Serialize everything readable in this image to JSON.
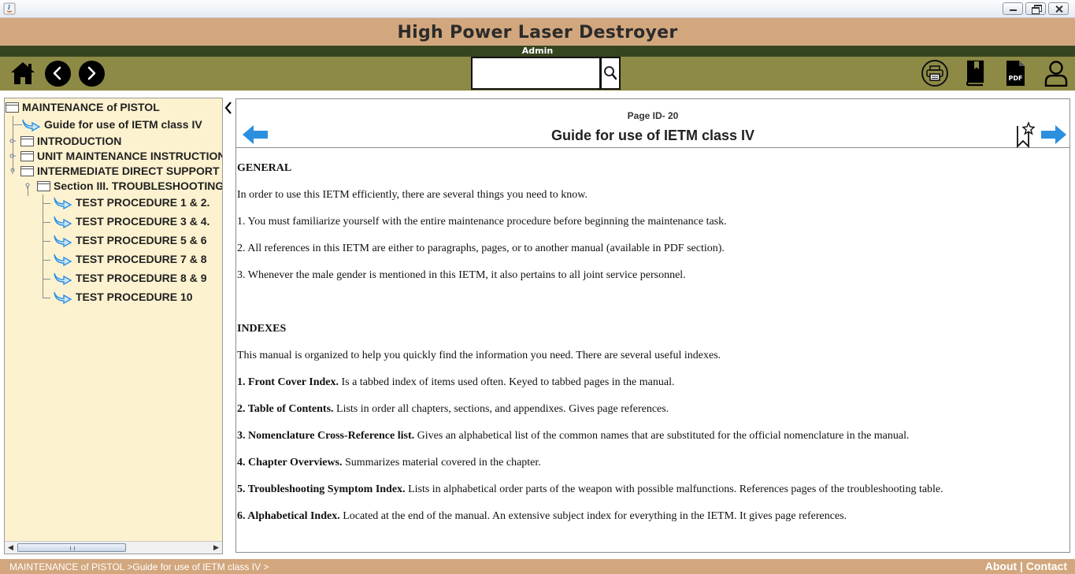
{
  "window": {
    "title": ""
  },
  "header": {
    "title": "High Power Laser Destroyer",
    "user": "Admin"
  },
  "toolbar": {
    "left_icons": [
      "home-icon",
      "back-icon",
      "forward-icon"
    ],
    "search": {
      "value": "",
      "placeholder": ""
    },
    "right_icons": [
      "printer-icon",
      "book-icon",
      "pdf-icon",
      "user-icon"
    ],
    "pdf_label": "PDF"
  },
  "sidebar": {
    "root": "MAINTENANCE of PISTOL",
    "items": [
      {
        "label": "Guide for use of IETM class IV",
        "type": "page"
      },
      {
        "label": "INTRODUCTION",
        "type": "folder"
      },
      {
        "label": "UNIT MAINTENANCE INSTRUCTION",
        "type": "folder"
      },
      {
        "label": "INTERMEDIATE DIRECT SUPPORT I",
        "type": "folder"
      },
      {
        "label": "Section III. TROUBLESHOOTING",
        "type": "folder"
      },
      {
        "label": "TEST PROCEDURE 1 & 2.",
        "type": "page"
      },
      {
        "label": "TEST PROCEDURE 3 & 4.",
        "type": "page"
      },
      {
        "label": "TEST PROCEDURE 5 & 6",
        "type": "page"
      },
      {
        "label": "TEST PROCEDURE 7 & 8",
        "type": "page"
      },
      {
        "label": "TEST PROCEDURE 8 & 9",
        "type": "page"
      },
      {
        "label": "TEST PROCEDURE 10",
        "type": "page"
      }
    ]
  },
  "content": {
    "page_id": "Page ID- 20",
    "title": "Guide for use of IETM class IV",
    "heading_general": "GENERAL",
    "general_intro": "In order to use this IETM efficiently, there are several things you need to know.",
    "general_items": [
      "1. You must familiarize yourself with the entire maintenance procedure before beginning the maintenance task.",
      "2. All references in this IETM are either to paragraphs, pages, or to another manual (available in PDF section).",
      "3. Whenever the male gender is mentioned in this IETM, it also pertains to all joint service personnel."
    ],
    "heading_indexes": "INDEXES",
    "indexes_intro": "This manual is organized to help you quickly find the information you need. There are several useful indexes.",
    "indexes": [
      {
        "term": "1. Front Cover Index.",
        "desc": " Is a tabbed index of items used often. Keyed to tabbed pages in the manual."
      },
      {
        "term": "2. Table of Contents.",
        "desc": " Lists in order all chapters, sections, and appendixes. Gives page references."
      },
      {
        "term": "3. Nomenclature Cross-Reference list.",
        "desc": " Gives an alphabetical list of the common names that are substituted for the official nomenclature in the manual."
      },
      {
        "term": "4. Chapter Overviews.",
        "desc": " Summarizes material covered in the chapter."
      },
      {
        "term": "5. Troubleshooting Symptom Index.",
        "desc": " Lists in alphabetical order parts of the weapon with possible malfunctions. References pages of the troubleshooting table."
      },
      {
        "term": "6. Alphabetical Index.",
        "desc": " Located at the end of the manual. An extensive subject index for everything in the IETM. It gives page references."
      }
    ]
  },
  "statusbar": {
    "breadcrumb": "MAINTENANCE of PISTOL >Guide for use of IETM class IV >",
    "about": "About",
    "separator": " | ",
    "contact": "Contact"
  },
  "colors": {
    "header_bg": "#d2a77e",
    "user_strip": "#35451e",
    "toolbar_bg": "#8d8a46",
    "sidebar_bg": "#fdf2cf",
    "accent_arrow": "#2b8fe0"
  }
}
